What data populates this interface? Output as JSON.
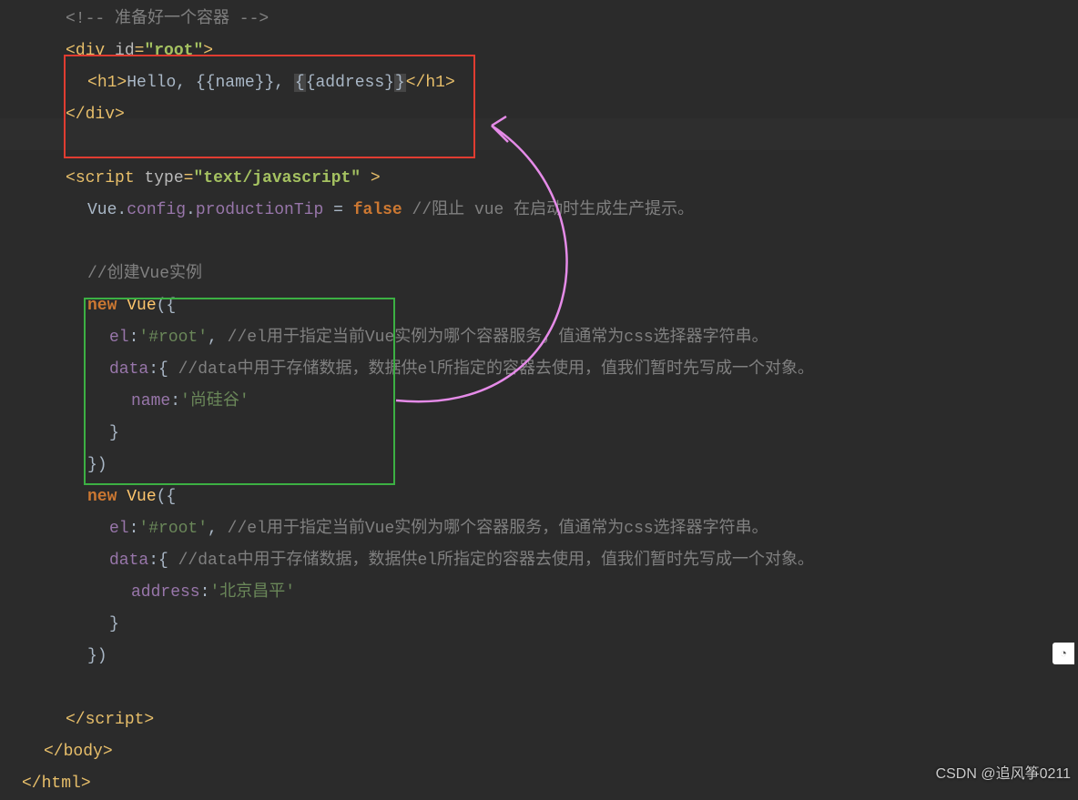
{
  "watermark": "CSDN @追风筝0211",
  "code": {
    "comment_prepare": "<!-- 准备好一个容器 -->",
    "div_open_tag": "div",
    "div_attr_name": "id",
    "div_attr_val": "\"root\"",
    "h1_tag": "h1",
    "h1_text_before": "Hello, ",
    "h1_expr1": "{{name}}",
    "h1_sep": ", ",
    "h1_expr2_open": "{",
    "h1_expr2_mid": "{address}",
    "h1_expr2_close": "}",
    "div_close": "div",
    "script_tag": "script",
    "script_attr_name": "type",
    "script_attr_val": "\"text/javascript\"",
    "vue_config_line_js": "Vue.config.productionTip = ",
    "vue_config_false": "false",
    "vue_config_cmt": " //阻止 vue 在启动时生成生产提示。",
    "cmt_create": "//创建Vue实例",
    "new_kw": "new",
    "vue_cls": "Vue",
    "el_key": "el",
    "el_val": "'#root'",
    "el_cmt": " //el用于指定当前Vue实例为哪个容器服务，值通常为css选择器字符串。",
    "data_key": "data",
    "data_cmt": " //data中用于存储数据，数据供el所指定的容器去使用，值我们暂时先写成一个对象。",
    "name_key": "name",
    "name_val": "'尚硅谷'",
    "address_key": "address",
    "address_val": "'北京昌平'",
    "body_tag": "body",
    "html_tag": "html"
  }
}
